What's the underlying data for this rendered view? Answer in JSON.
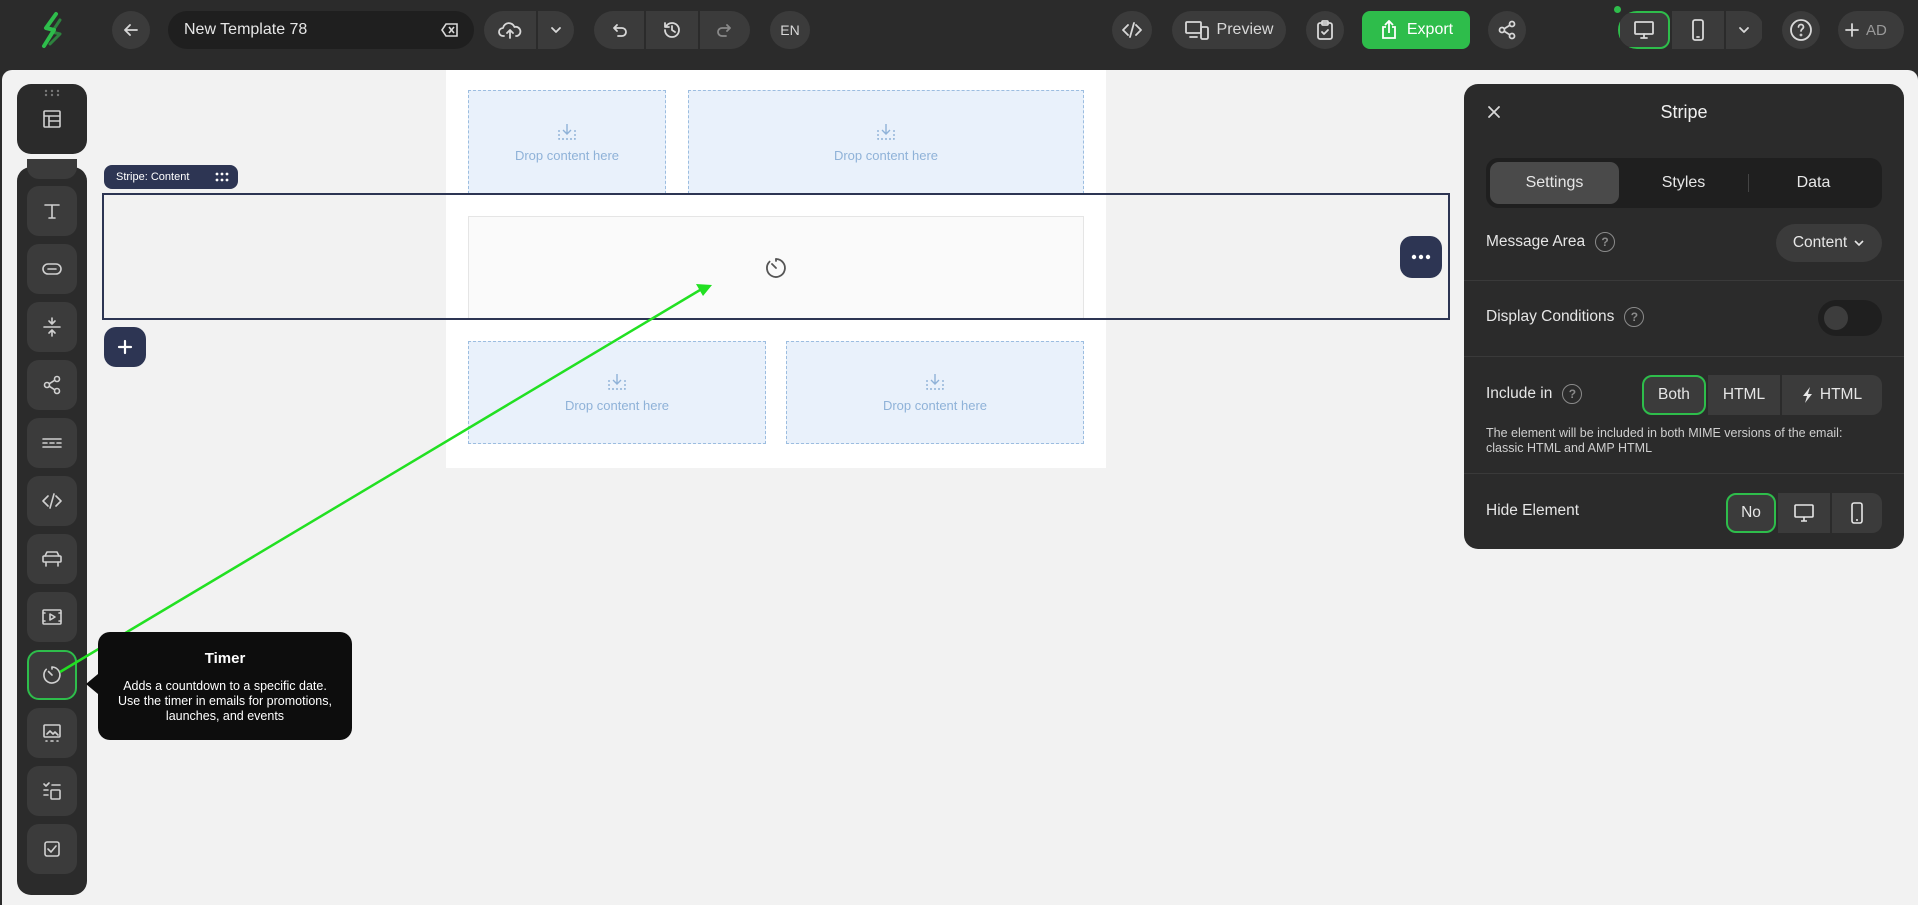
{
  "topbar": {
    "template_name": "New Template 78",
    "language": "EN",
    "preview_label": "Preview",
    "export_label": "Export",
    "user_initials": "AD",
    "accent_color": "#2ebd4b"
  },
  "toolbar": {
    "tools": [
      "text-block",
      "button-block",
      "spacer-block",
      "social-block",
      "menu-block",
      "html-block",
      "banner-block",
      "video-block",
      "timer-block",
      "amp-carousel-block",
      "amp-accordion-block",
      "amp-form-block"
    ]
  },
  "email": {
    "drop_label": "Drop content here"
  },
  "stripe": {
    "label": "Stripe: Content"
  },
  "tooltip": {
    "title": "Timer",
    "description": "Adds a countdown to a specific date. Use the timer in emails for promotions, launches, and events"
  },
  "panel": {
    "title": "Stripe",
    "tabs": [
      "Settings",
      "Styles",
      "Data"
    ],
    "message_area_label": "Message Area",
    "message_area_value": "Content",
    "display_conditions_label": "Display Conditions",
    "display_conditions_on": false,
    "include_in_label": "Include in",
    "include_options": [
      "Both",
      "HTML",
      "HTML"
    ],
    "include_selected": "Both",
    "include_note": "The element will be included in both MIME versions of the email: classic HTML and AMP HTML",
    "hide_element_label": "Hide Element",
    "hide_options": [
      "No"
    ],
    "hide_selected": "No"
  }
}
